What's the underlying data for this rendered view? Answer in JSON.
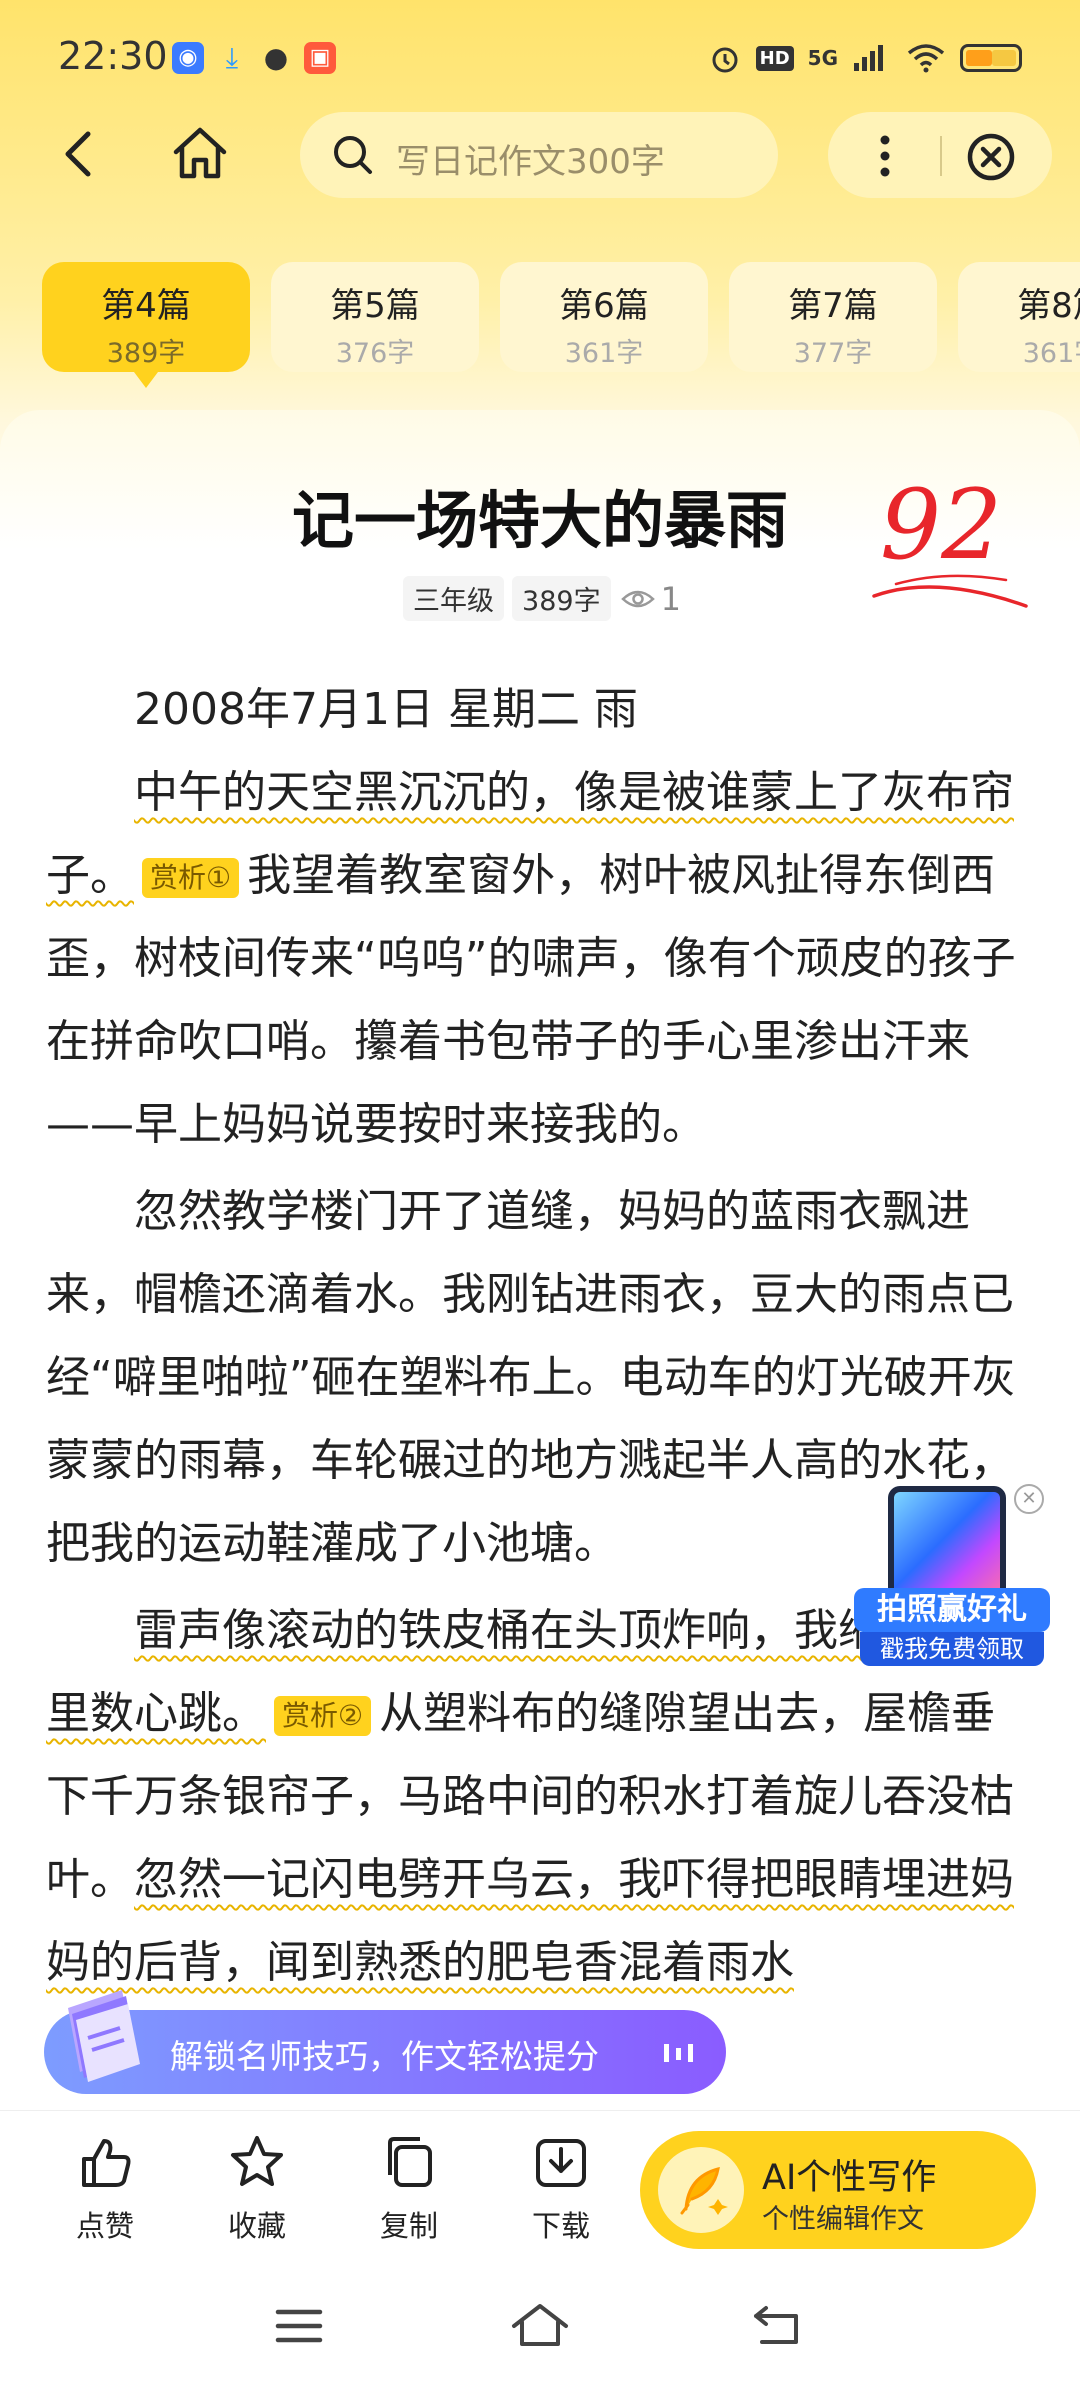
{
  "status_bar": {
    "time": "22:30",
    "network": "5G",
    "hd": "HD"
  },
  "header": {
    "search_placeholder": "写日记作文300字"
  },
  "tabs": [
    {
      "label": "第4篇",
      "count": "389字",
      "active": true
    },
    {
      "label": "第5篇",
      "count": "376字"
    },
    {
      "label": "第6篇",
      "count": "361字"
    },
    {
      "label": "第7篇",
      "count": "377字"
    },
    {
      "label": "第8篇",
      "count": "361字"
    }
  ],
  "article": {
    "title": "记一场特大的暴雨",
    "score": "92",
    "grade": "三年级",
    "word_count": "389字",
    "views": "1",
    "date_line": "2008年7月1日 星期二 雨",
    "p1_underlined": "中午的天空黑沉沉的，像是被谁蒙上了灰布帘子。",
    "badge1": "赏析①",
    "p1_rest": "我望着教室窗外，树叶被风扯得东倒西歪，树枝间传来“呜呜”的啸声，像有个顽皮的孩子在拼命吹口哨。攥着书包带子的手心里渗出汗来——早上妈妈说要按时来接我的。",
    "p2": "忽然教学楼门开了道缝，妈妈的蓝雨衣飘进来，帽檐还滴着水。我刚钻进雨衣，豆大的雨点已经“噼里啪啦”砸在塑料布上。电动车的灯光破开灰蒙蒙的雨幕，车轮碾过的地方溅起半人高的水花，把我的运动鞋灌成了小池塘。",
    "p3_underlined": "雷声像滚动的铁皮桶在头顶炸响，我缩在雨衣里数心跳。",
    "badge2": "赏析②",
    "p3_mid": "从塑料布的缝隙望出去，屋檐垂下千万条银帘子，马路中间的积水打着旋儿吞没枯叶。",
    "p3_underlined2": "忽然一记闪电劈开乌云，我吓得把眼睛埋进妈妈的后背，闻到熟悉的肥皂香混着雨水"
  },
  "ad": {
    "line1": "拍照赢好礼",
    "line2": "戳我免费领取"
  },
  "unlock_banner": {
    "text": "解锁名师技巧，作文轻松提分"
  },
  "actions": {
    "like": "点赞",
    "favorite": "收藏",
    "copy": "复制",
    "download": "下载",
    "ai_title": "AI个性写作",
    "ai_subtitle": "个性编辑作文"
  },
  "colors": {
    "accent": "#ffd21e",
    "score_red": "#e8262b",
    "underline": "#e8b400"
  }
}
